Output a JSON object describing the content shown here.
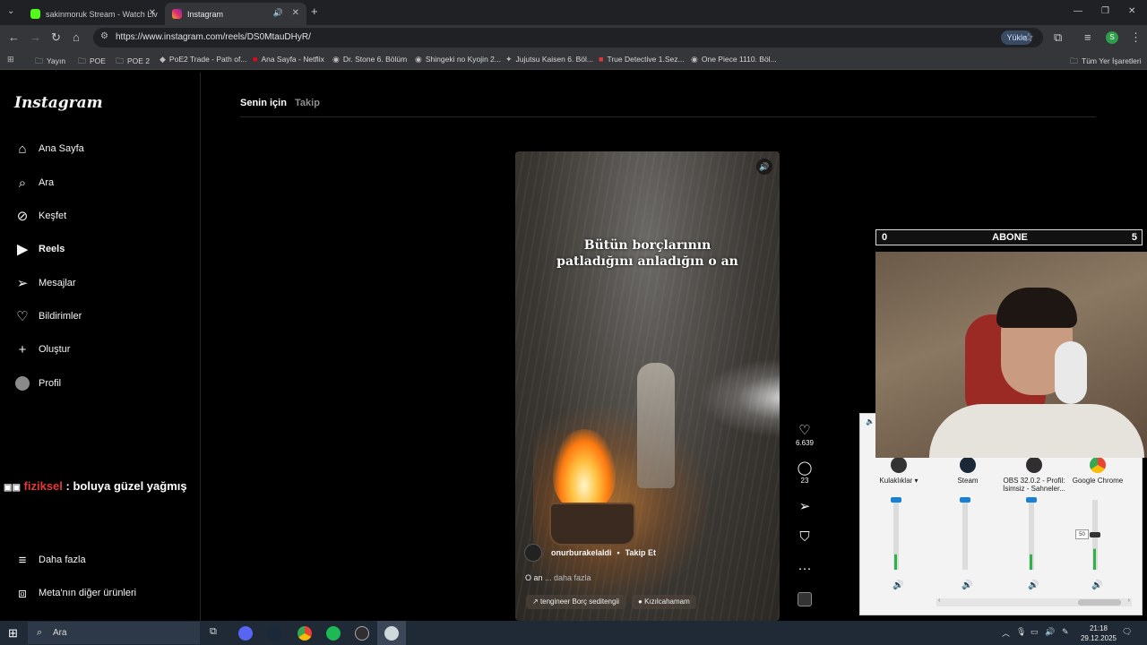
{
  "browser": {
    "tabs": [
      {
        "title": "sakinmoruk Stream - Watch Liv",
        "active": false
      },
      {
        "title": "Instagram",
        "active": true
      }
    ],
    "new_tab": "+",
    "url": "https://www.instagram.com/reels/DS0MtauDHyR/",
    "yukle": "Yükle",
    "profile_initial": "S",
    "bookmarks": [
      "Yayın",
      "POE",
      "POE 2",
      "PoE2 Trade - Path of...",
      "Ana Sayfa - Netflix",
      "Dr. Stone 6. Bölüm",
      "Shingeki no Kyojin 2...",
      "Jujutsu Kaisen 6. Böl...",
      "True Detective 1.Sez...",
      "One Piece 1110. Böl..."
    ],
    "all_bookmarks": "Tüm Yer İşaretleri"
  },
  "instagram": {
    "logo": "Instagram",
    "nav": [
      {
        "label": "Ana Sayfa",
        "icon": "home-icon"
      },
      {
        "label": "Ara",
        "icon": "search-icon"
      },
      {
        "label": "Keşfet",
        "icon": "compass-icon"
      },
      {
        "label": "Reels",
        "icon": "reels-icon"
      },
      {
        "label": "Mesajlar",
        "icon": "messages-icon"
      },
      {
        "label": "Bildirimler",
        "icon": "heart-icon"
      },
      {
        "label": "Oluştur",
        "icon": "plus-icon"
      },
      {
        "label": "Profil",
        "icon": "avatar-icon"
      }
    ],
    "more": "Daha fazla",
    "meta_products": "Meta'nın diğer ürünleri",
    "feed_tabs": [
      "Senin için",
      "Takip"
    ],
    "reel": {
      "caption_line1": "Bütün borçlarının",
      "caption_line2": "patladığını anladığın o an",
      "username": "onurburakelaldi",
      "follow": "Takip Et",
      "description": "O an",
      "more": "... daha fazla",
      "audio": "tengineer Borç  seditengii",
      "location": "Kızılcahamam"
    },
    "actions": {
      "likes": "6.639",
      "comments": "23"
    }
  },
  "stream_overlay": {
    "chat_user": "fiziksel",
    "chat_message": ": boluya güzel yağmış",
    "abone_left": "0",
    "abone_label": "ABONE",
    "abone_right": "5"
  },
  "volume_mixer": {
    "columns": [
      {
        "label": "Kulaklıklar",
        "level": 0.22,
        "volume": 1.0
      },
      {
        "label": "Steam",
        "level": 0.0,
        "volume": 1.0
      },
      {
        "label": "OBS 32.0.2 - Profil: İsimsiz - Sahneler...",
        "level": 0.22,
        "volume": 1.0
      },
      {
        "label": "Google Chrome",
        "level": 0.3,
        "volume": 0.5
      }
    ],
    "tooltip": "50"
  },
  "taskbar": {
    "search": "Ara",
    "time": "21:18",
    "date": "29.12.2025"
  }
}
